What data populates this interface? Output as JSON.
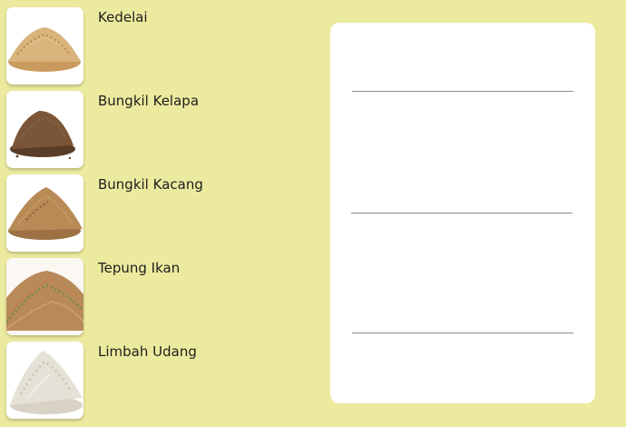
{
  "ingredients": [
    {
      "label": "Kedelai",
      "image": "soybean-pile-image"
    },
    {
      "label": "Bungkil Kelapa",
      "image": "coconut-meal-pile-image"
    },
    {
      "label": "Bungkil Kacang",
      "image": "peanut-meal-pile-image"
    },
    {
      "label": "Tepung Ikan",
      "image": "fish-meal-pile-image"
    },
    {
      "label": "Limbah Udang",
      "image": "shrimp-waste-pile-image"
    }
  ],
  "drop_panel": {
    "slots": 3
  },
  "colors": {
    "background": "#ecea9f",
    "panel": "#ffffff",
    "line": "#8c8c8c"
  }
}
